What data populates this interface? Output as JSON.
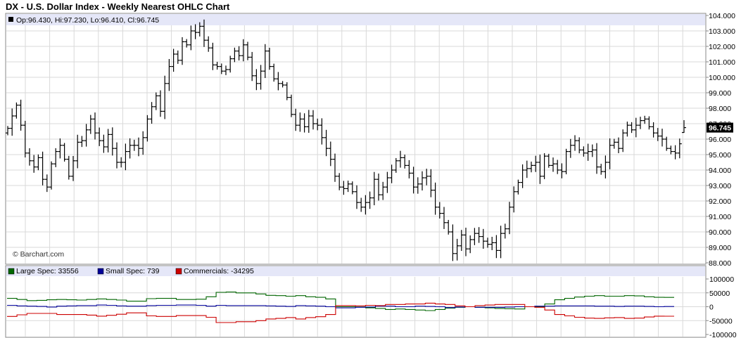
{
  "title": "DX - U.S. Dollar Index - Weekly Nearest OHLC Chart",
  "ohlc_legend": "Op:96.430, Hi:97.230, Lo:96.410, Cl:96.745",
  "copyright": "© Barchart.com",
  "last_price_label": "96.745",
  "colors": {
    "grid": "#d9d9d9",
    "legend_band": "#e5e7f8",
    "price_bar": "#000000",
    "large_spec": "#006600",
    "small_spec": "#000099",
    "commercials": "#cc0000",
    "frame": "#888888"
  },
  "chart_data": [
    {
      "type": "ohlc",
      "title": "DX - U.S. Dollar Index - Weekly Nearest OHLC Chart",
      "ylim": [
        88,
        104
      ],
      "y_ticks": [
        "104.000",
        "103.000",
        "102.000",
        "101.000",
        "100.000",
        "99.000",
        "98.000",
        "97.000",
        "96.000",
        "95.000",
        "94.000",
        "93.000",
        "92.000",
        "91.000",
        "90.000",
        "89.000",
        "88.000"
      ],
      "last": {
        "open": 96.43,
        "high": 97.23,
        "low": 96.41,
        "close": 96.745
      },
      "closes": [
        96.7,
        97.5,
        98.2,
        96.9,
        95.1,
        94.6,
        94.2,
        94.8,
        93.4,
        92.9,
        94.4,
        95.2,
        95.6,
        94.7,
        93.6,
        94.6,
        95.8,
        95.9,
        96.6,
        97.3,
        96.4,
        95.9,
        95.5,
        96.3,
        95.4,
        94.5,
        94.5,
        95.2,
        95.6,
        95.6,
        95.4,
        96.1,
        97.3,
        98.1,
        98.8,
        97.8,
        99.6,
        100.7,
        101.5,
        101.1,
        102.3,
        102.1,
        103.0,
        102.9,
        103.3,
        102.4,
        101.9,
        100.8,
        100.7,
        100.4,
        100.5,
        101.2,
        101.7,
        101.4,
        102.1,
        101.3,
        100.1,
        99.6,
        100.4,
        101.7,
        100.7,
        99.9,
        99.6,
        99.5,
        98.7,
        97.6,
        96.9,
        97.3,
        96.8,
        97.5,
        97.0,
        96.9,
        96.1,
        95.4,
        94.7,
        93.6,
        92.9,
        92.8,
        93.1,
        92.6,
        91.9,
        91.6,
        91.9,
        92.2,
        93.4,
        92.4,
        92.9,
        93.5,
        94.0,
        94.6,
        94.8,
        94.3,
        93.8,
        92.9,
        93.1,
        93.5,
        93.6,
        92.7,
        91.6,
        91.2,
        90.6,
        90.0,
        88.6,
        89.1,
        89.8,
        88.9,
        89.5,
        89.9,
        89.7,
        89.4,
        89.2,
        89.3,
        88.8,
        89.9,
        90.2,
        91.6,
        92.6,
        93.2,
        94.0,
        94.1,
        94.3,
        94.5,
        93.6,
        94.9,
        94.3,
        94.4,
        94.0,
        93.9,
        95.2,
        95.6,
        95.9,
        95.3,
        95.1,
        95.2,
        95.3,
        94.2,
        93.9,
        94.5,
        95.6,
        95.8,
        95.4,
        96.4,
        96.9,
        96.6,
        96.9,
        97.2,
        97.3,
        96.8,
        96.4,
        96.2,
        96.0,
        95.4,
        95.2,
        95.1,
        95.7,
        96.745
      ]
    },
    {
      "type": "line",
      "title": "COT",
      "ylim": [
        -100000,
        100000
      ],
      "y_ticks": [
        "100000",
        "50000",
        "0",
        "-50000",
        "-100000"
      ],
      "series": [
        {
          "name": "Large Spec: 33556",
          "color": "#006600",
          "values": [
            30000,
            26000,
            22000,
            23000,
            25000,
            26000,
            25000,
            24000,
            26000,
            28000,
            26000,
            24000,
            20000,
            20000,
            29000,
            30000,
            30000,
            26000,
            26000,
            27000,
            36000,
            52000,
            53000,
            50000,
            50000,
            46000,
            41000,
            40000,
            38000,
            40000,
            36000,
            34000,
            28000,
            0,
            0,
            -1000,
            -4000,
            -6000,
            -10000,
            -8000,
            -10000,
            -12000,
            -14000,
            -10000,
            -5000,
            -2000,
            0,
            -2000,
            -4000,
            -6000,
            -7000,
            -8000,
            0,
            0,
            10000,
            25000,
            30000,
            35000,
            38000,
            40000,
            38000,
            38000,
            40000,
            39000,
            36000,
            34000,
            33556
          ]
        },
        {
          "name": "Small Spec: 739",
          "color": "#000099",
          "values": [
            5000,
            3000,
            2000,
            1000,
            -1000,
            2000,
            3000,
            4000,
            4000,
            6000,
            5000,
            3000,
            2000,
            2000,
            4000,
            5000,
            5000,
            6000,
            6000,
            5000,
            2000,
            5000,
            4000,
            4000,
            4000,
            4000,
            3000,
            2000,
            1000,
            4000,
            3000,
            2000,
            0,
            -4000,
            -4000,
            -2000,
            -1000,
            2000,
            2000,
            0,
            0,
            2000,
            1000,
            0,
            -3000,
            -1000,
            0,
            -2000,
            -2000,
            -2000,
            -1000,
            0,
            0,
            2000,
            2000,
            3000,
            3000,
            3000,
            3000,
            2000,
            2000,
            1000,
            2000,
            2000,
            1000,
            0,
            739
          ]
        },
        {
          "name": "Commercials: -34295",
          "color": "#cc0000",
          "values": [
            -35000,
            -29000,
            -24000,
            -24000,
            -24000,
            -28000,
            -28000,
            -28000,
            -30000,
            -34000,
            -31000,
            -27000,
            -22000,
            -22000,
            -33000,
            -35000,
            -35000,
            -32000,
            -32000,
            -32000,
            -38000,
            -57000,
            -57000,
            -54000,
            -54000,
            -50000,
            -44000,
            -42000,
            -39000,
            -44000,
            -39000,
            -36000,
            -28000,
            4000,
            4000,
            3000,
            5000,
            4000,
            8000,
            8000,
            10000,
            10000,
            13000,
            10000,
            8000,
            3000,
            0,
            4000,
            6000,
            8000,
            8000,
            8000,
            0,
            -2000,
            -12000,
            -28000,
            -33000,
            -38000,
            -41000,
            -42000,
            -40000,
            -39000,
            -42000,
            -41000,
            -37000,
            -34000,
            -34295
          ]
        }
      ]
    }
  ]
}
